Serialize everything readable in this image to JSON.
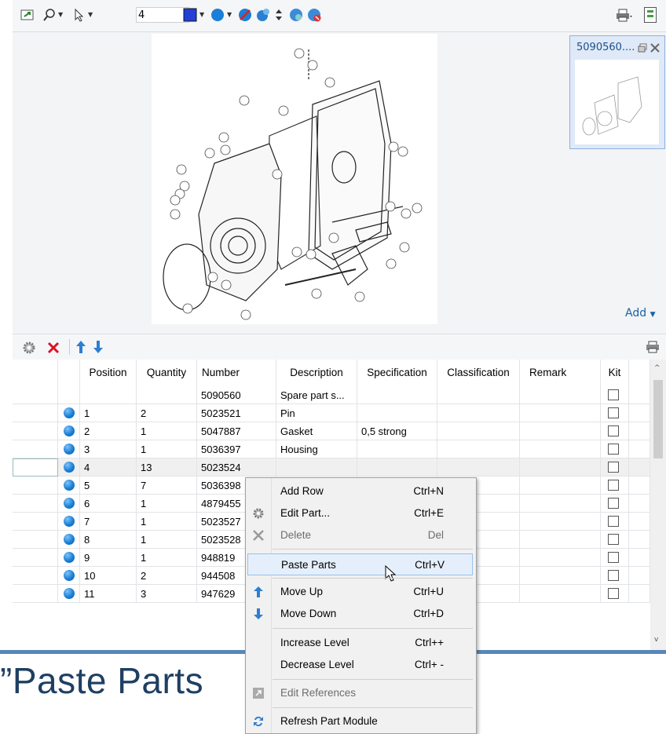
{
  "toolbar": {
    "zoom_value": "4",
    "icons": [
      "export-icon",
      "search-icon",
      "pointer-icon",
      "color-square-icon",
      "blue-circle-icon",
      "hide-icon",
      "balloon-icon",
      "updown-icon",
      "info-icon",
      "remove-icon",
      "print-icon",
      "layout-icon"
    ]
  },
  "viewer": {
    "thumbnail_title": "5090560....",
    "add_label": "Add"
  },
  "parts_toolbar": {
    "icons": [
      "settings-icon",
      "delete-icon",
      "move-up-icon",
      "move-down-icon",
      "print-icon"
    ]
  },
  "grid": {
    "columns": [
      "Position",
      "Quantity",
      "Number",
      "Description",
      "Specification",
      "Classification",
      "Remark",
      "Kit"
    ],
    "rows": [
      {
        "position": "",
        "quantity": "",
        "number": "5090560",
        "description": "Spare part s...",
        "specification": "",
        "bullet": false
      },
      {
        "position": "1",
        "quantity": "2",
        "number": "5023521",
        "description": "Pin",
        "specification": "",
        "bullet": true
      },
      {
        "position": "2",
        "quantity": "1",
        "number": "5047887",
        "description": "Gasket",
        "specification": "0,5 strong",
        "bullet": true
      },
      {
        "position": "3",
        "quantity": "1",
        "number": "5036397",
        "description": "Housing",
        "specification": "",
        "bullet": true
      },
      {
        "position": "4",
        "quantity": "13",
        "number": "5023524",
        "description": "",
        "specification": "",
        "bullet": true
      },
      {
        "position": "5",
        "quantity": "7",
        "number": "5036398",
        "description": "",
        "specification": "",
        "bullet": true
      },
      {
        "position": "6",
        "quantity": "1",
        "number": "4879455",
        "description": "",
        "specification": "",
        "bullet": true
      },
      {
        "position": "7",
        "quantity": "1",
        "number": "5023527",
        "description": "",
        "specification": "",
        "bullet": true
      },
      {
        "position": "8",
        "quantity": "1",
        "number": "5023528",
        "description": "",
        "specification": "",
        "bullet": true
      },
      {
        "position": "9",
        "quantity": "1",
        "number": "948819",
        "description": "",
        "specification": "",
        "bullet": true
      },
      {
        "position": "10",
        "quantity": "2",
        "number": "944508",
        "description": "",
        "specification": "",
        "bullet": true
      },
      {
        "position": "11",
        "quantity": "3",
        "number": "947629",
        "description": "",
        "specification": "",
        "bullet": true
      }
    ]
  },
  "context_menu": {
    "items": [
      {
        "label": "Add Row",
        "shortcut": "Ctrl+N"
      },
      {
        "label": "Edit Part...",
        "shortcut": "Ctrl+E"
      },
      {
        "label": "Delete",
        "shortcut": "Del"
      },
      {
        "label": "Paste Parts",
        "shortcut": "Ctrl+V"
      },
      {
        "label": "Move Up",
        "shortcut": "Ctrl+U"
      },
      {
        "label": "Move Down",
        "shortcut": "Ctrl+D"
      },
      {
        "label": "Increase Level",
        "shortcut": "Ctrl++"
      },
      {
        "label": "Decrease Level",
        "shortcut": "Ctrl+ -"
      },
      {
        "label": "Edit References",
        "shortcut": ""
      },
      {
        "label": "Refresh Part Module",
        "shortcut": ""
      }
    ]
  },
  "footer": {
    "caption": "”Paste Parts"
  },
  "colors": {
    "accent": "#1a7fd6",
    "menu_hover": "#e5effb",
    "footer_text": "#1f3f62"
  }
}
